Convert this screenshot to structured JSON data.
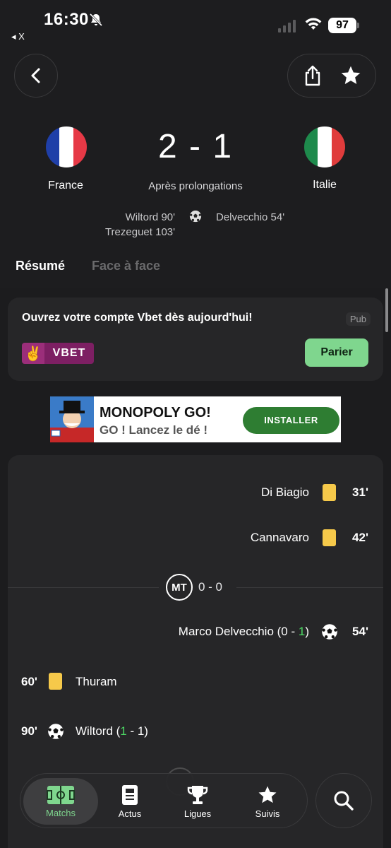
{
  "status_bar": {
    "time": "16:30",
    "battery": "97",
    "back_app": "◂ X"
  },
  "header": {
    "back_icon": "chevron-left-icon",
    "share_icon": "share-icon",
    "favorite_icon": "star-icon"
  },
  "match": {
    "home": {
      "name": "France",
      "flag_colors": [
        "#1f3fa8",
        "#ffffff",
        "#e63946"
      ]
    },
    "away": {
      "name": "Italie",
      "flag_colors": [
        "#1e8a4c",
        "#ffffff",
        "#e03c3c"
      ]
    },
    "score": "2 - 1",
    "status": "Après prolongations",
    "home_scorers": [
      "Wiltord 90'",
      "Trezeguet 103'"
    ],
    "away_scorers": [
      "Delvecchio 54'"
    ]
  },
  "tabs": [
    {
      "label": "Résumé",
      "active": true
    },
    {
      "label": "Face à face",
      "active": false
    }
  ],
  "ad_card": {
    "title": "Ouvrez votre compte Vbet dès aujourd'hui!",
    "pub_label": "Pub",
    "brand": "VBET",
    "button": "Parier"
  },
  "banner": {
    "title": "MONOPOLY GO!",
    "subtitle": "GO ! Lancez le dé !",
    "button": "INSTALLER"
  },
  "events": {
    "away1": {
      "player": "Di Biagio",
      "minute": "31'"
    },
    "away2": {
      "player": "Cannavaro",
      "minute": "42'"
    },
    "halftime": {
      "label": "MT",
      "score": "0 - 0"
    },
    "goal_away": {
      "player": "Marco Delvecchio (0 - ",
      "green": "1",
      "close": ")",
      "minute": "54'"
    },
    "home1": {
      "minute": "60'",
      "player": "Thuram"
    },
    "goal_home": {
      "minute": "90'",
      "player": "Wiltord (",
      "green": "1",
      "rest": " - 1)"
    }
  },
  "nav": [
    {
      "label": "Matchs",
      "icon": "pitch-icon",
      "active": true
    },
    {
      "label": "Actus",
      "icon": "news-icon",
      "active": false
    },
    {
      "label": "Ligues",
      "icon": "trophy-icon",
      "active": false
    },
    {
      "label": "Suivis",
      "icon": "star-icon",
      "active": false
    }
  ],
  "nav_search_icon": "search-icon"
}
